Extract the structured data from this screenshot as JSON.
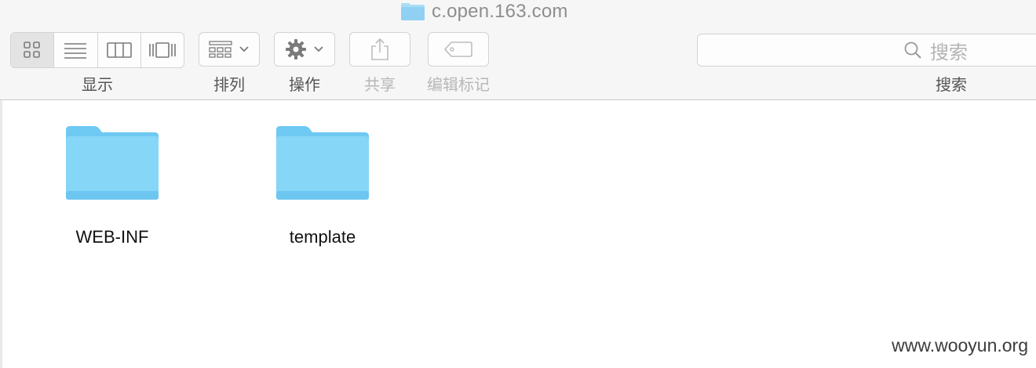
{
  "window": {
    "title": "c.open.163.com"
  },
  "toolbar": {
    "view_label": "显示",
    "sort_label": "排列",
    "action_label": "操作",
    "share_label": "共享",
    "tags_label": "编辑标记",
    "search_label": "搜索",
    "search_placeholder": "搜索",
    "active_view": "icon",
    "view_modes": [
      "icon-view",
      "list-view",
      "column-view",
      "cover-flow-view"
    ]
  },
  "files": [
    {
      "name": "WEB-INF",
      "kind": "folder"
    },
    {
      "name": "template",
      "kind": "folder"
    }
  ],
  "watermark": "www.wooyun.org",
  "colors": {
    "folder": "#7fd3f7",
    "toolbar_bg": "#f6f6f6",
    "label_active": "#555555",
    "label_disabled": "#b7b7b7"
  }
}
